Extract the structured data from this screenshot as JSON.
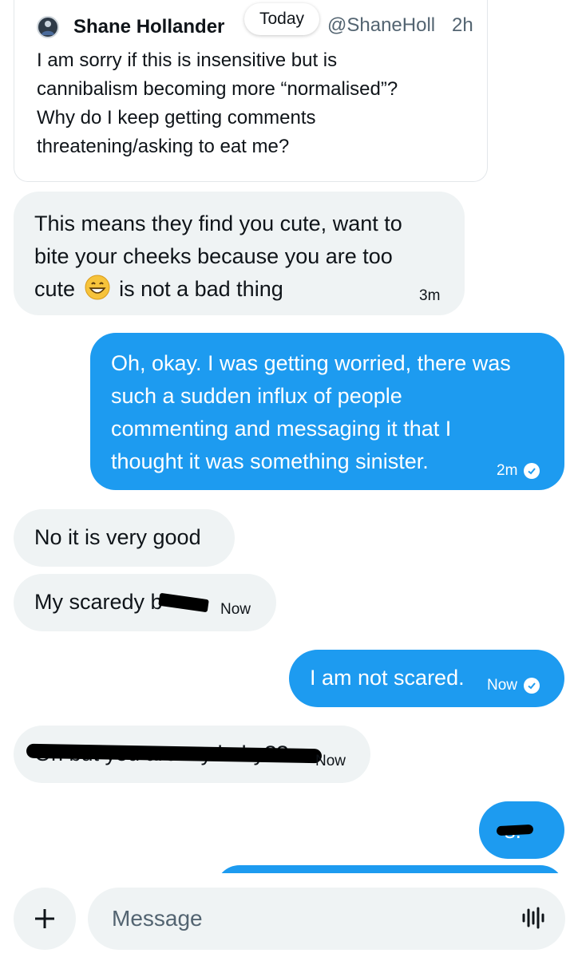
{
  "quoted_post": {
    "author_name": "Shane Hollander",
    "handle": "ShaneHoll",
    "time": "2h",
    "lines": [
      "I am sorry if this is insensitive but is",
      "cannibalism becoming more “normalised”?",
      "Why do I keep getting comments",
      "threatening/asking to eat me?"
    ]
  },
  "date_separator": "Today",
  "messages": [
    {
      "direction": "incoming",
      "lines": [
        "This means they find you cute, want to",
        "bite your cheeks because you are too"
      ],
      "last_line_before_emoji": "cute",
      "emoji": "grinning-face-emoji",
      "last_line_after_emoji": "is not a bad thing",
      "time": "3m"
    },
    {
      "direction": "outgoing",
      "lines": [
        "Oh, okay. I was getting worried, there was",
        "such a sudden influx of people",
        "commenting and messaging it that I",
        "thought it was something sinister."
      ],
      "time": "2m",
      "status_icon": "check-circle-icon"
    },
    {
      "direction": "incoming",
      "text": "No it is very good"
    },
    {
      "direction": "incoming",
      "text": "My scaredy b",
      "time": "Now",
      "redacted_tail": true
    },
    {
      "direction": "outgoing",
      "text": "I am not scared.",
      "time": "Now",
      "status_icon": "check-circle-icon"
    },
    {
      "direction": "incoming",
      "text": "Oh but you are my baby??",
      "time": "Now",
      "redacted": true
    },
    {
      "direction": "outgoing",
      "text": "s.",
      "redacted_head": true
    }
  ],
  "composer": {
    "placeholder": "Message",
    "add_icon": "plus-icon",
    "voice_icon": "audio-waveform-icon"
  },
  "colors": {
    "outgoing_bubble": "#1d9bf0",
    "incoming_bubble": "#eff3f4",
    "text": "#0f1419",
    "secondary_text": "#536471"
  }
}
